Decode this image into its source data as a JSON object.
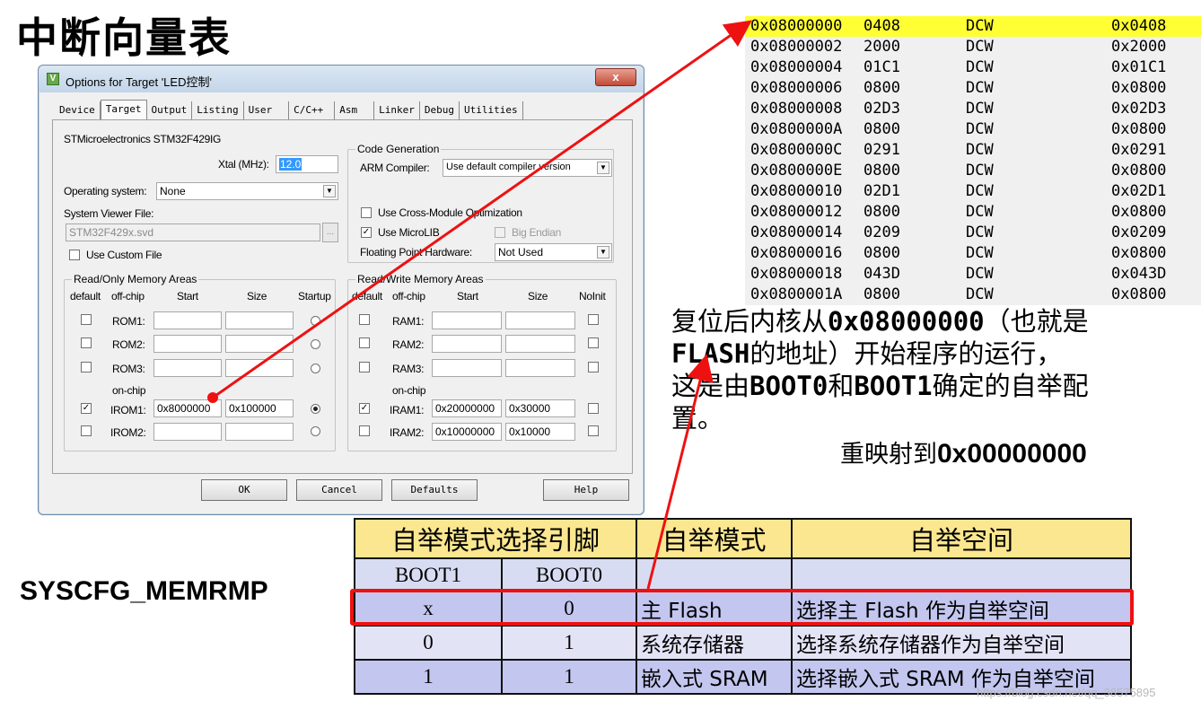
{
  "page_title": "中断向量表",
  "dialog": {
    "title": "Options for Target 'LED控制'",
    "close_label": "x",
    "tabs": [
      "Device",
      "Target",
      "Output",
      "Listing",
      "User",
      "C/C++",
      "Asm",
      "Linker",
      "Debug",
      "Utilities"
    ],
    "active_tab": "Target",
    "device_name": "STMicroelectronics STM32F429IG",
    "xtal_label": "Xtal (MHz):",
    "xtal_value": "12.0",
    "os_label": "Operating system:",
    "os_value": "None",
    "svd_label": "System Viewer File:",
    "svd_value": "STM32F429x.svd",
    "svd_browse": "...",
    "use_custom_file": "Use Custom File",
    "code_gen": {
      "title": "Code Generation",
      "arm_compiler_label": "ARM Compiler:",
      "arm_compiler_value": "Use default compiler version",
      "cross_module": "Use Cross-Module Optimization",
      "microlib": "Use MicroLIB",
      "big_endian": "Big Endian",
      "fp_label": "Floating Point Hardware:",
      "fp_value": "Not Used"
    },
    "ro_mem": {
      "title": "Read/Only Memory Areas",
      "headers": [
        "default",
        "off-chip",
        "Start",
        "Size",
        "Startup"
      ],
      "onchip_label": "on-chip",
      "rows": [
        {
          "name": "ROM1:",
          "start": "",
          "size": "",
          "default": false,
          "startup": false
        },
        {
          "name": "ROM2:",
          "start": "",
          "size": "",
          "default": false,
          "startup": false
        },
        {
          "name": "ROM3:",
          "start": "",
          "size": "",
          "default": false,
          "startup": false
        },
        {
          "name": "IROM1:",
          "start": "0x8000000",
          "size": "0x100000",
          "default": true,
          "startup": true
        },
        {
          "name": "IROM2:",
          "start": "",
          "size": "",
          "default": false,
          "startup": false
        }
      ]
    },
    "rw_mem": {
      "title": "Read/Write Memory Areas",
      "headers": [
        "default",
        "off-chip",
        "Start",
        "Size",
        "NoInit"
      ],
      "onchip_label": "on-chip",
      "rows": [
        {
          "name": "RAM1:",
          "start": "",
          "size": ""
        },
        {
          "name": "RAM2:",
          "start": "",
          "size": ""
        },
        {
          "name": "RAM3:",
          "start": "",
          "size": ""
        },
        {
          "name": "IRAM1:",
          "start": "0x20000000",
          "size": "0x30000"
        },
        {
          "name": "IRAM2:",
          "start": "0x10000000",
          "size": "0x10000"
        }
      ]
    },
    "buttons": {
      "ok": "OK",
      "cancel": "Cancel",
      "defaults": "Defaults",
      "help": "Help"
    }
  },
  "memory": {
    "marker": ">",
    "rows": [
      {
        "addr": "0x08000000",
        "data": "0408",
        "op": "DCW",
        "val": "0x0408"
      },
      {
        "addr": "0x08000002",
        "data": "2000",
        "op": "DCW",
        "val": "0x2000"
      },
      {
        "addr": "0x08000004",
        "data": "01C1",
        "op": "DCW",
        "val": "0x01C1"
      },
      {
        "addr": "0x08000006",
        "data": "0800",
        "op": "DCW",
        "val": "0x0800"
      },
      {
        "addr": "0x08000008",
        "data": "02D3",
        "op": "DCW",
        "val": "0x02D3"
      },
      {
        "addr": "0x0800000A",
        "data": "0800",
        "op": "DCW",
        "val": "0x0800"
      },
      {
        "addr": "0x0800000C",
        "data": "0291",
        "op": "DCW",
        "val": "0x0291"
      },
      {
        "addr": "0x0800000E",
        "data": "0800",
        "op": "DCW",
        "val": "0x0800"
      },
      {
        "addr": "0x08000010",
        "data": "02D1",
        "op": "DCW",
        "val": "0x02D1"
      },
      {
        "addr": "0x08000012",
        "data": "0800",
        "op": "DCW",
        "val": "0x0800"
      },
      {
        "addr": "0x08000014",
        "data": "0209",
        "op": "DCW",
        "val": "0x0209"
      },
      {
        "addr": "0x08000016",
        "data": "0800",
        "op": "DCW",
        "val": "0x0800"
      },
      {
        "addr": "0x08000018",
        "data": "043D",
        "op": "DCW",
        "val": "0x043D"
      },
      {
        "addr": "0x0800001A",
        "data": "0800",
        "op": "DCW",
        "val": "0x0800"
      }
    ]
  },
  "description": {
    "line1_a": "复位后内核从",
    "line1_b": "0x08000000",
    "line1_c": "（也就是",
    "line2_a": "FLASH",
    "line2_b": "的地址）开始程序的运行，",
    "line3_a": "这是由",
    "line3_b": "BOOT0",
    "line3_c": "和",
    "line3_d": "BOOT1",
    "line3_e": "确定的自举配",
    "line4": "置。"
  },
  "remap": {
    "prefix": "重映射到",
    "addr": "0x00000000"
  },
  "syscfg_label": "SYSCFG_MEMRMP",
  "boot_table": {
    "headers": [
      "自举模式选择引脚",
      "自举模式",
      "自举空间"
    ],
    "subheaders": [
      "BOOT1",
      "BOOT0"
    ],
    "rows": [
      {
        "boot1": "x",
        "boot0": "0",
        "mode": "主 Flash",
        "space": "选择主 Flash 作为自举空间"
      },
      {
        "boot1": "0",
        "boot0": "1",
        "mode": "系统存储器",
        "space": "选择系统存储器作为自举空间"
      },
      {
        "boot1": "1",
        "boot0": "1",
        "mode": "嵌入式 SRAM",
        "space": "选择嵌入式 SRAM 作为自举空间"
      }
    ]
  },
  "watermark": "https://blog.csdn.net/qq_38575895",
  "colors": {
    "accent_red": "#ee1111",
    "selection_yellow": "#ffff33",
    "table_header": "#fbe78f"
  }
}
